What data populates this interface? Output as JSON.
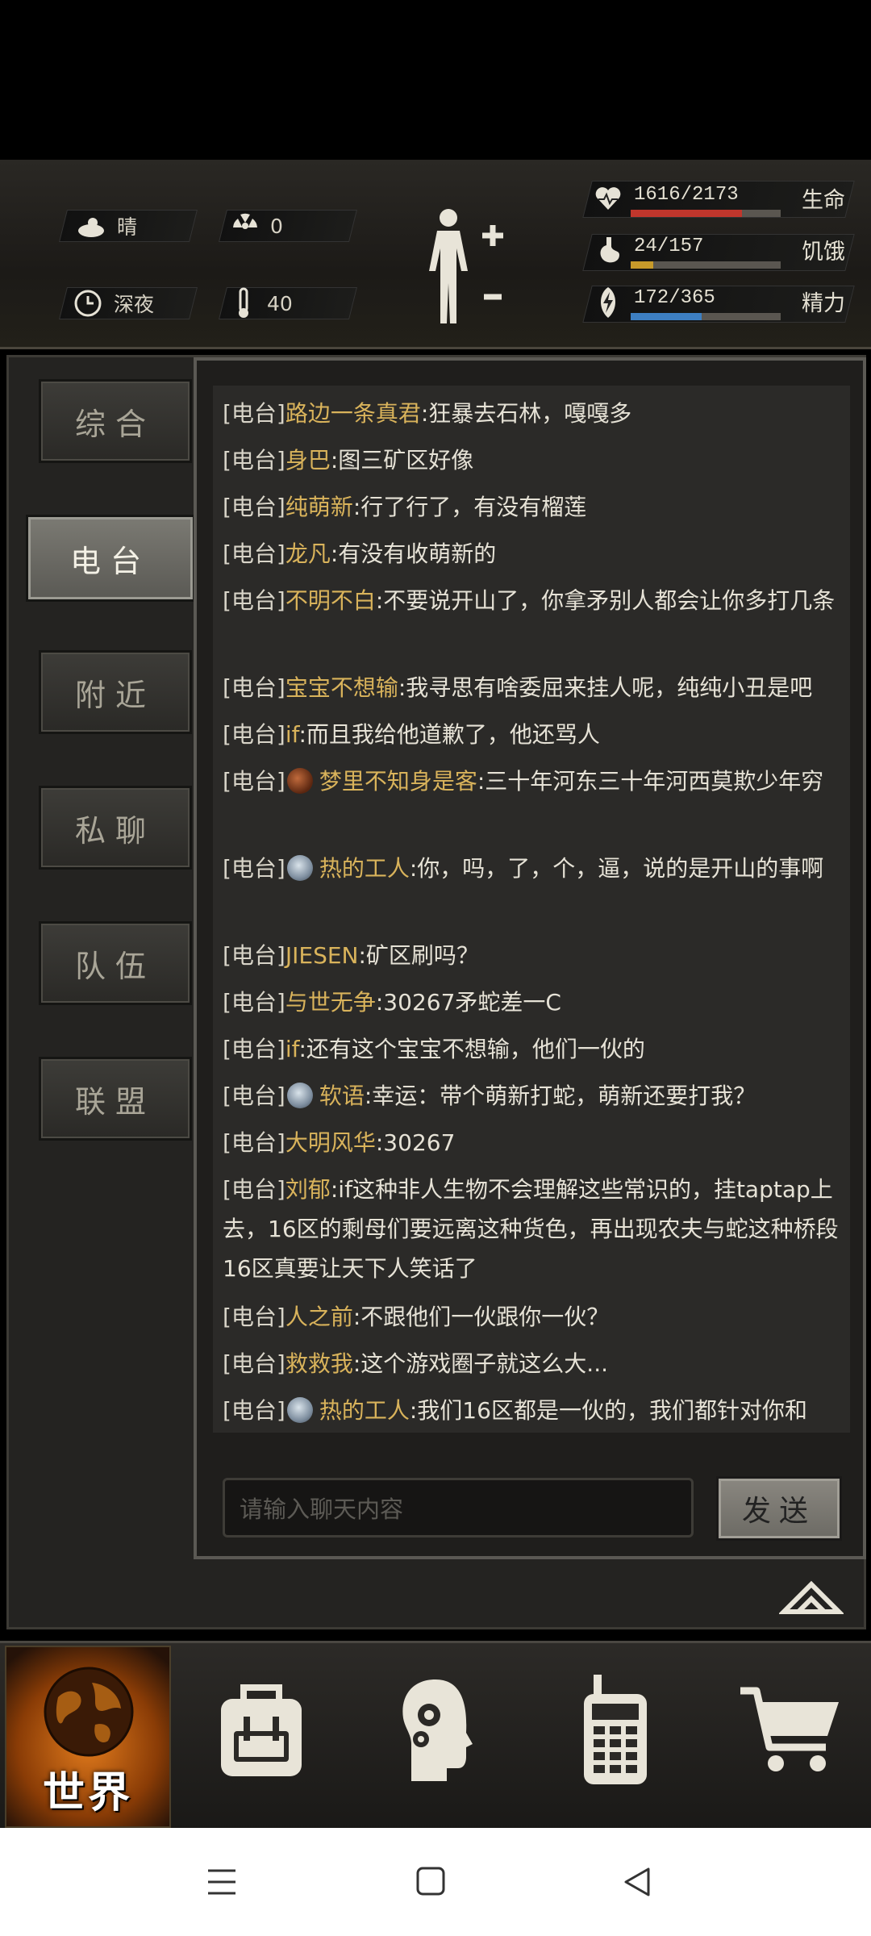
{
  "status": {
    "weather": "晴",
    "radiation": "0",
    "time_of_day": "深夜",
    "temperature": "40",
    "health": {
      "text": "1616/2173",
      "label": "生命",
      "value": 1616,
      "max": 2173,
      "color": "#c0362c"
    },
    "hunger": {
      "text": "24/157",
      "label": "饥饿",
      "value": 24,
      "max": 157,
      "color": "#c79a2a"
    },
    "energy": {
      "text": "172/365",
      "label": "精力",
      "value": 172,
      "max": 365,
      "color": "#3d7fc2"
    }
  },
  "tabs": [
    {
      "label": "综合",
      "active": false
    },
    {
      "label": "电台",
      "active": true
    },
    {
      "label": "附近",
      "active": false
    },
    {
      "label": "私聊",
      "active": false
    },
    {
      "label": "队伍",
      "active": false
    },
    {
      "label": "联盟",
      "active": false
    }
  ],
  "chat": {
    "channel": "[电台]",
    "messages": [
      {
        "name": "路边一条真君",
        "text": ":狂暴去石林，嘎嘎多"
      },
      {
        "name": "身巴",
        "text": ":图三矿区好像"
      },
      {
        "name": "纯萌新",
        "text": ":行了行了，有没有榴莲"
      },
      {
        "name": "龙凡",
        "text": ":有没有收萌新的"
      },
      {
        "name": "不明不白",
        "text": ":不要说开山了，你拿矛别人都会让你多打几条"
      },
      {
        "name": "宝宝不想输",
        "text": ":我寻思有啥委屈来挂人呢，纯纯小丑是吧"
      },
      {
        "name": "if",
        "text": ":而且我给他道歉了，他还骂人"
      },
      {
        "name": "梦里不知身是客",
        "text": ":三十年河东三十年河西莫欺少年穷",
        "icon": "brown"
      },
      {
        "name": "热的工人",
        "text": ":你，吗，了，个，逼，说的是开山的事啊",
        "icon": "blue"
      },
      {
        "name": "JIESEN",
        "text": ":矿区刷吗？"
      },
      {
        "name": "与世无争",
        "text": ":30267矛蛇差一C"
      },
      {
        "name": "if",
        "text": ":还有这个宝宝不想输，他们一伙的"
      },
      {
        "name": "软语",
        "text": ":幸运：带个萌新打蛇，萌新还要打我？",
        "icon": "blue"
      },
      {
        "name": "大明风华",
        "text": ":30267"
      },
      {
        "name": "刘郁",
        "text": ":if这种非人生物不会理解这些常识的，挂taptap上去，16区的剩母们要远离这种货色，再出现农夫与蛇这种桥段16区真要让天下人笑话了"
      },
      {
        "name": "人之前",
        "text": ":不跟他们一伙跟你一伙？"
      },
      {
        "name": "救救我",
        "text": ":这个游戏圈子就这么大..."
      },
      {
        "name": "热的工人",
        "text": ":我们16区都是一伙的，我们都针对你和",
        "icon": "blue"
      }
    ]
  },
  "input": {
    "placeholder": "请输入聊天内容",
    "send_label": "发送"
  },
  "bottom_nav": {
    "world_label": "世界"
  }
}
